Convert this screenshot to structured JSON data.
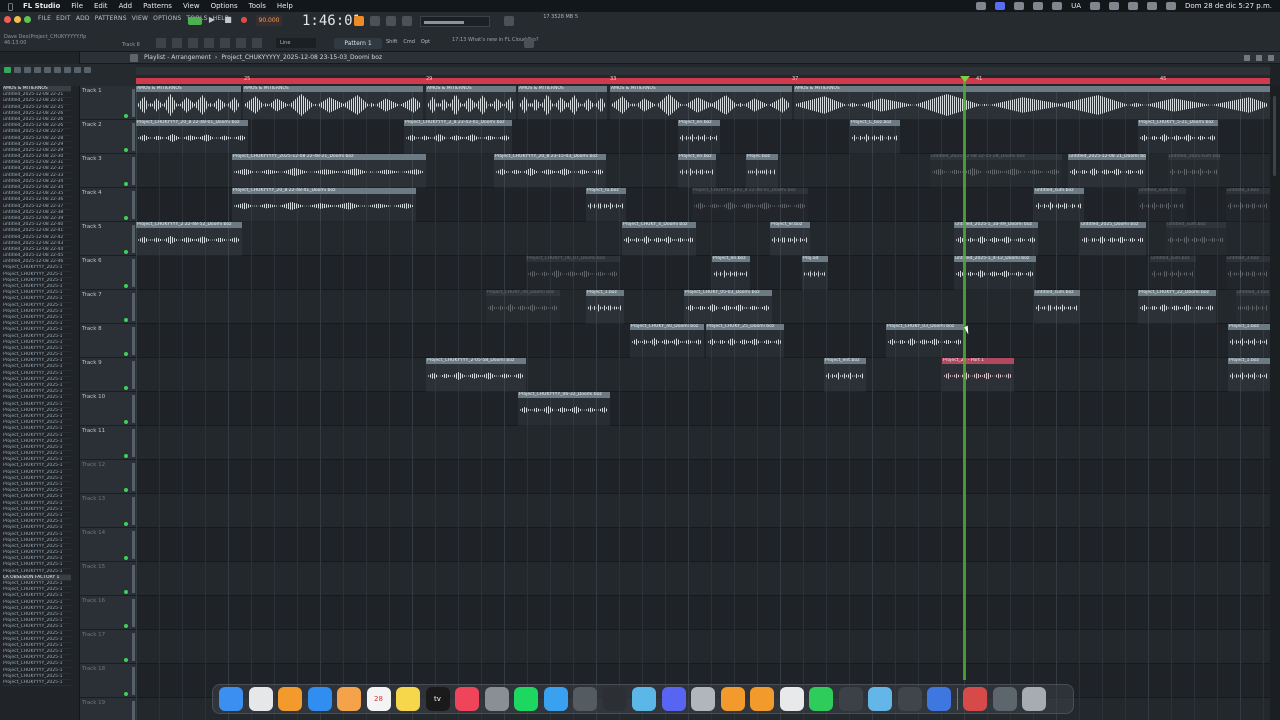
{
  "menubar": {
    "app": "FL Studio",
    "menus": [
      "File",
      "Edit",
      "Add",
      "Patterns",
      "View",
      "Options",
      "Tools",
      "Help"
    ],
    "lang": "UA",
    "datetime": "Dom 28 de dic  5:27 p.m."
  },
  "fl": {
    "menu": [
      "FILE",
      "EDIT",
      "ADD",
      "PATTERNS",
      "VIEW",
      "OPTIONS",
      "TOOLS",
      "HELP"
    ],
    "tempo": "90.000",
    "clock": "1:46:01",
    "cpu": "17    3528 MB\n5",
    "hint_line1": "Dave Deo(Project_CHUKYYYYY.flp",
    "hint_line2": "46:13:00",
    "track_hint": "Track 8",
    "line_mode": "Line",
    "pattern": "Pattern 1",
    "snap_opts": [
      "Shift",
      "Cmd",
      "Opt"
    ],
    "news": "17:13  What's new in FL\nCloud Pro?"
  },
  "playlist": {
    "title": "Playlist - Arrangement",
    "project": "Project_CHUKYYYYY_2025-12-08 23-15-03_Doomi boz",
    "ruler_numbers": [
      "25",
      "29",
      "33",
      "37",
      "41",
      "45"
    ]
  },
  "tracks": [
    {
      "name": "Track 1"
    },
    {
      "name": "Track 2"
    },
    {
      "name": "Track 3"
    },
    {
      "name": "Track 4"
    },
    {
      "name": "Track 5"
    },
    {
      "name": "Track 6"
    },
    {
      "name": "Track 7"
    },
    {
      "name": "Track 8"
    },
    {
      "name": "Track 9"
    },
    {
      "name": "Track 10"
    },
    {
      "name": "Track 11"
    },
    {
      "name": "Track 12"
    },
    {
      "name": "Track 13"
    },
    {
      "name": "Track 14"
    },
    {
      "name": "Track 15"
    },
    {
      "name": "Track 16"
    },
    {
      "name": "Track 17"
    },
    {
      "name": "Track 18"
    },
    {
      "name": "Track 19"
    }
  ],
  "clips": [
    {
      "track": 0,
      "from": 0,
      "to": 105,
      "label": "AMOS & MITIERNOS",
      "big": true
    },
    {
      "track": 0,
      "from": 107,
      "to": 287,
      "label": "AMOS & MITIERNOS",
      "big": true
    },
    {
      "track": 0,
      "from": 290,
      "to": 380,
      "label": "AMOS & MITIERNOS",
      "big": true
    },
    {
      "track": 0,
      "from": 382,
      "to": 471,
      "label": "AMOS & MITIERNOS",
      "big": true
    },
    {
      "track": 0,
      "from": 474,
      "to": 656,
      "label": "AMOS & MITIERNOS",
      "big": true
    },
    {
      "track": 0,
      "from": 658,
      "to": 1134,
      "label": "AMOS & MITIERNOS",
      "big": true
    },
    {
      "track": 1,
      "from": 0,
      "to": 112,
      "label": "Project_CHUKYYYY_20_8 22-48-01_Doomi boz"
    },
    {
      "track": 1,
      "from": 268,
      "to": 376,
      "label": "Project_CHUKYYYY_2_8 23-43-01_Doomi boz"
    },
    {
      "track": 1,
      "from": 542,
      "to": 584,
      "label": "Project_en.boz"
    },
    {
      "track": 1,
      "from": 714,
      "to": 764,
      "label": "Project_C_boz.boz"
    },
    {
      "track": 1,
      "from": 1002,
      "to": 1082,
      "label": "Project_CHUKYY_5-21_Doomi boz"
    },
    {
      "track": 2,
      "from": 96,
      "to": 290,
      "label": "Project_CHUKYYYYY_2025-12-08 22-48-21_Doomi boz"
    },
    {
      "track": 2,
      "from": 358,
      "to": 470,
      "label": "Project_CHUKYYYY_20_8 23-15-03_Doomi boz"
    },
    {
      "track": 2,
      "from": 542,
      "to": 580,
      "label": "Project_en.boz"
    },
    {
      "track": 2,
      "from": 610,
      "to": 642,
      "label": "Projec.boz"
    },
    {
      "track": 2,
      "from": 794,
      "to": 926,
      "label": "untitled_2025-12-08 22-15-28_Doomi boz",
      "faint": true
    },
    {
      "track": 2,
      "from": 932,
      "to": 1010,
      "label": "untitled_2025-12-08 21_Doomi boz"
    },
    {
      "track": 2,
      "from": 1032,
      "to": 1084,
      "label": "untitled_2025-sum boz",
      "faint": true
    },
    {
      "track": 3,
      "from": 96,
      "to": 280,
      "label": "Project_CHUKYYYY_20_8 22-48-41_Doomi boz"
    },
    {
      "track": 3,
      "from": 450,
      "to": 490,
      "label": "Project_ru.boz"
    },
    {
      "track": 3,
      "from": 556,
      "to": 672,
      "label": "Project_CHUKYYY_202_8 22-48-01_Doomi boz",
      "faint": true
    },
    {
      "track": 3,
      "from": 898,
      "to": 948,
      "label": "untitled_sum.boz"
    },
    {
      "track": 3,
      "from": 1002,
      "to": 1050,
      "label": "untitled_sum.boz",
      "faint": true
    },
    {
      "track": 3,
      "from": 1090,
      "to": 1134,
      "label": "untitled_3.boz",
      "faint": true
    },
    {
      "track": 4,
      "from": 0,
      "to": 106,
      "label": "Project_CHUKYYYY_2 22-48-52_Doomi boz"
    },
    {
      "track": 4,
      "from": 486,
      "to": 560,
      "label": "Project_CHUKY_4_Doomi boz"
    },
    {
      "track": 4,
      "from": 634,
      "to": 674,
      "label": "Project_er.boz"
    },
    {
      "track": 4,
      "from": 818,
      "to": 902,
      "label": "untitled_2025-1_3a-49_Doomi boz"
    },
    {
      "track": 4,
      "from": 944,
      "to": 1010,
      "label": "untitled_2025_Doomi boz"
    },
    {
      "track": 4,
      "from": 1030,
      "to": 1090,
      "label": "untitled_sum.boz",
      "faint": true
    },
    {
      "track": 5,
      "from": 390,
      "to": 484,
      "label": "Project_CHUKYY_06_07_Doomi boz",
      "faint": true
    },
    {
      "track": 5,
      "from": 576,
      "to": 614,
      "label": "Project_en.boz"
    },
    {
      "track": 5,
      "from": 666,
      "to": 692,
      "label": "Proj.ad"
    },
    {
      "track": 5,
      "from": 818,
      "to": 900,
      "label": "untitled_2025-1_4-12_Doomi boz"
    },
    {
      "track": 5,
      "from": 1014,
      "to": 1060,
      "label": "untitled_sum.boz",
      "faint": true
    },
    {
      "track": 5,
      "from": 1090,
      "to": 1134,
      "label": "untitled_3.boz",
      "faint": true
    },
    {
      "track": 6,
      "from": 350,
      "to": 424,
      "label": "Project_CHUKY_06_Doomi boz",
      "faint": true
    },
    {
      "track": 6,
      "from": 450,
      "to": 488,
      "label": "Project_1.boz"
    },
    {
      "track": 6,
      "from": 548,
      "to": 636,
      "label": "Project_CHUKY_05-03_Doomi boz"
    },
    {
      "track": 6,
      "from": 898,
      "to": 944,
      "label": "untitled_sum.boz"
    },
    {
      "track": 6,
      "from": 1002,
      "to": 1080,
      "label": "Project_CHUKYY_22_Doomi boz"
    },
    {
      "track": 6,
      "from": 1100,
      "to": 1134,
      "label": "untitled_3.boz",
      "faint": true
    },
    {
      "track": 7,
      "from": 494,
      "to": 568,
      "label": "Project_CHUKY_40_Doomi boz"
    },
    {
      "track": 7,
      "from": 570,
      "to": 648,
      "label": "Project_CHUKY_25_Doomi boz"
    },
    {
      "track": 7,
      "from": 750,
      "to": 828,
      "label": "Project_CHUKY_03_Doomi boz"
    },
    {
      "track": 7,
      "from": 1092,
      "to": 1134,
      "label": "Project_1.boz"
    },
    {
      "track": 8,
      "from": 290,
      "to": 390,
      "label": "Project_CHUKYYYY_2-05-58_Doomi boz"
    },
    {
      "track": 8,
      "from": 688,
      "to": 730,
      "label": "Project_ent.boz"
    },
    {
      "track": 8,
      "from": 806,
      "to": 878,
      "label": "Project_28 - Part 1",
      "pink": true
    },
    {
      "track": 8,
      "from": 1092,
      "to": 1134,
      "label": "Project_1.boz"
    },
    {
      "track": 9,
      "from": 382,
      "to": 474,
      "label": "Project_CHUKYYYY_06-32_Doomi boz"
    }
  ],
  "browser_items": [
    "AMOS & MITIERNOS",
    "untitled_2025-12-08 22-21",
    "untitled_2025-12-08 22-21",
    "untitled_2025-12-08 22-25",
    "untitled_2025-12-08 22-26",
    "untitled_2025-12-08 22-26",
    "untitled_2025-12-08 22-26",
    "untitled_2025-12-08 22-27",
    "untitled_2025-12-08 22-28",
    "untitled_2025-12-08 22-29",
    "untitled_2025-12-08 22-29",
    "untitled_2025-12-08 22-30",
    "untitled_2025-12-08 22-31",
    "untitled_2025-12-08 22-32",
    "untitled_2025-12-08 22-33",
    "untitled_2025-12-08 22-34",
    "untitled_2025-12-08 22-34",
    "untitled_2025-12-08 22-35",
    "untitled_2025-12-08 22-36",
    "untitled_2025-12-08 22-37",
    "untitled_2025-12-08 22-38",
    "untitled_2025-12-08 22-39",
    "untitled_2025-12-08 22-40",
    "untitled_2025-12-08 22-41",
    "untitled_2025-12-08 22-42",
    "untitled_2025-12-08 22-43",
    "untitled_2025-12-08 22-44",
    "untitled_2025-12-08 22-45",
    "untitled_2025-12-08 22-46",
    "Project_CHUKYYYY_2025-1",
    "Project_CHUKYYYY_2025-1",
    "Project_CHUKYYYY_2025-1",
    "Project_CHUKYYYY_2025-1",
    "Project_CHUKYYYY_2025-1",
    "Project_CHUKYYYY_2025-1",
    "Project_CHUKYYYY_2025-1",
    "Project_CHUKYYYY_2025-1",
    "Project_CHUKYYYY_2025-1",
    "Project_CHUKYYYY_2025-1",
    "Project_CHUKYYYY_2025-1",
    "Project_CHUKYYYY_2025-1",
    "Project_CHUKYYYY_2025-1",
    "Project_CHUKYYYY_2025-1",
    "Project_CHUKYYYY_2025-1",
    "Project_CHUKYYYY_2025-1",
    "Project_CHUKYYYY_2025-1",
    "Project_CHUKYYYY_2025-1",
    "Project_CHUKYYYY_2025-1",
    "Project_CHUKYYYY_2025-1",
    "Project_CHUKYYYY_2025-1",
    "Project_CHUKYYYY_2025-1",
    "Project_CHUKYYYY_2025-1",
    "Project_CHUKYYYY_2025-1",
    "Project_CHUKYYYY_2025-1",
    "Project_CHUKYYYY_2025-1",
    "Project_CHUKYYYY_2025-1",
    "Project_CHUKYYYY_2025-1",
    "Project_CHUKYYYY_2025-1",
    "Project_CHUKYYYY_2025-1",
    "Project_CHUKYYYY_2025-1",
    "Project_CHUKYYYY_2025-1",
    "Project_CHUKYYYY_2025-1",
    "Project_CHUKYYYY_2025-1",
    "Project_CHUKYYYY_2025-1",
    "Project_CHUKYYYY_2025-1",
    "Project_CHUKYYYY_2025-1",
    "Project_CHUKYYYY_2025-1",
    "Project_CHUKYYYY_2025-1",
    "Project_CHUKYYYY_2025-1",
    "Project_CHUKYYYY_2025-1",
    "Project_CHUKYYYY_2025-1",
    "Project_CHUKYYYY_2025-1",
    "Project_CHUKYYYY_2025-1",
    "Project_CHUKYYYY_2025-1",
    "Project_CHUKYYYY_2025-1",
    "Project_CHUKYYYY_2025-1",
    "Project_CHUKYYYY_2025-1",
    "Project_CHUKYYYY_2025-1",
    "Project_CHUKYYYY_2025-1",
    "LA OBSESION FACTORY 1",
    "Project_CHUKYYYY_2025-1",
    "Project_CHUKYYYY_2025-1",
    "Project_CHUKYYYY_2025-1",
    "Project_CHUKYYYY_2025-1",
    "Project_CHUKYYYY_2025-1",
    "Project_CHUKYYYY_2025-1",
    "Project_CHUKYYYY_2025-1",
    "Project_CHUKYYYY_2025-1",
    "Project_CHUKYYYY_2025-1",
    "Project_CHUKYYYY_2025-1",
    "Project_CHUKYYYY_2025-1",
    "Project_CHUKYYYY_2025-1",
    "Project_CHUKYYYY_2025-1",
    "Project_CHUKYYYY_2025-1",
    "Project_CHUKYYYY_2025-1",
    "Project_CHUKYYYY_2025-1",
    "Project_CHUKYYYY_2025-1"
  ],
  "dock": [
    {
      "name": "finder-icon",
      "color": "#3b8ff0"
    },
    {
      "name": "chrome-icon",
      "color": "#e5e7e9"
    },
    {
      "name": "fl-studio-icon",
      "color": "#f29a2c"
    },
    {
      "name": "app-store-icon",
      "color": "#2f8ef0"
    },
    {
      "name": "photos-icon",
      "color": "#f4a34a"
    },
    {
      "name": "calendar-icon",
      "color": "#f4f4f4",
      "label": "28"
    },
    {
      "name": "notes-icon",
      "color": "#f6d64a"
    },
    {
      "name": "apple-tv-icon",
      "color": "#1a1a1a",
      "label": "tv"
    },
    {
      "name": "music-icon",
      "color": "#f0445a"
    },
    {
      "name": "settings-icon",
      "color": "#8a8f94"
    },
    {
      "name": "spotify-icon",
      "color": "#1ed760"
    },
    {
      "name": "safari-icon",
      "color": "#3aa0f0"
    },
    {
      "name": "logic-icon",
      "color": "#545b61"
    },
    {
      "name": "compass-icon",
      "color": "#2c3034"
    },
    {
      "name": "audio-app-icon",
      "color": "#5ab7e8"
    },
    {
      "name": "discord-icon",
      "color": "#5865f2"
    },
    {
      "name": "tool-icon",
      "color": "#b0b6bb"
    },
    {
      "name": "fl-studio-2-icon",
      "color": "#f29a2c"
    },
    {
      "name": "fl-studio-3-icon",
      "color": "#f29a2c"
    },
    {
      "name": "preview-icon",
      "color": "#e7e9eb"
    },
    {
      "name": "facetime-icon",
      "color": "#2ecc5a"
    },
    {
      "name": "plugin-icon",
      "color": "#3b4146"
    },
    {
      "name": "plugin-2-icon",
      "color": "#64b5e8"
    },
    {
      "name": "pen-icon",
      "color": "#3f4549"
    },
    {
      "name": "activity-icon",
      "color": "#3f77e0"
    },
    {
      "name": "downloads-icon",
      "color": "#d64a4a"
    },
    {
      "name": "folder-icon",
      "color": "#5d666c"
    },
    {
      "name": "trash-icon",
      "color": "#a6acb1"
    }
  ]
}
